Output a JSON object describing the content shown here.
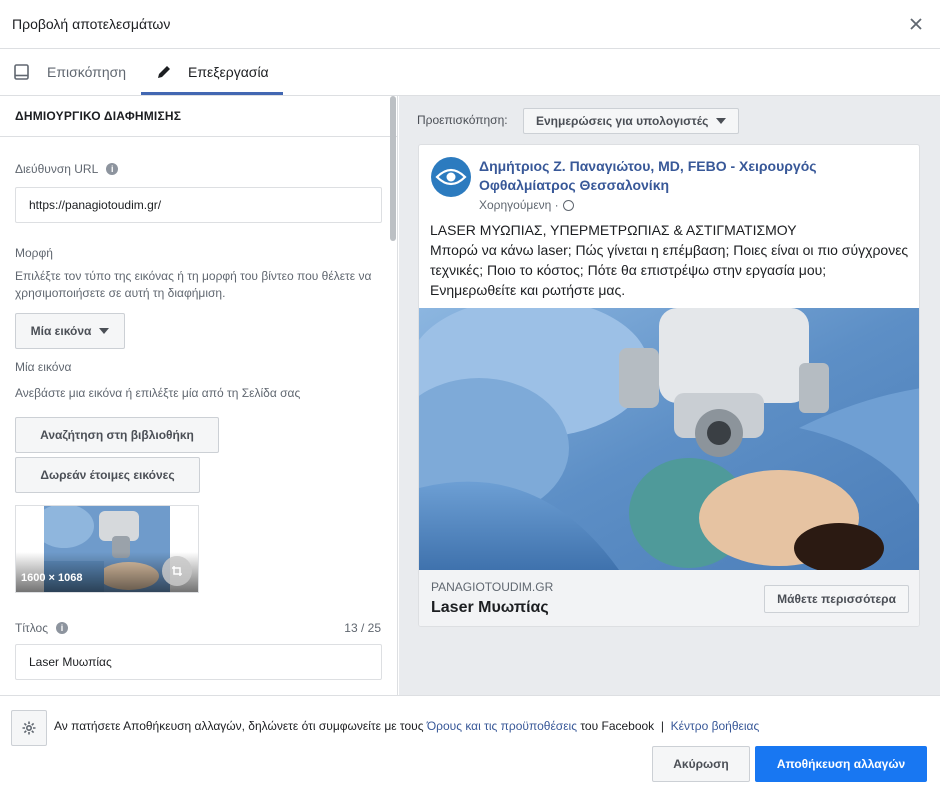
{
  "header": {
    "title": "Προβολή αποτελεσμάτων",
    "close_icon": "close-icon"
  },
  "tabs": [
    {
      "label": "Επισκόπηση",
      "icon": "tablet-icon"
    },
    {
      "label": "Επεξεργασία",
      "icon": "pencil-icon",
      "active": true
    }
  ],
  "left": {
    "section_title": "ΔΗΜΙΟΥΡΓΙΚΟ ΔΙΑΦΗΜΙΣΗΣ",
    "url_label": "Διεύθυνση URL",
    "url_value": "https://panagiotoudim.gr/",
    "format_label": "Μορφή",
    "format_help": "Επιλέξτε τον τύπο της εικόνας ή τη μορφή του βίντεο που θέλετε να χρησιμοποιήσετε σε αυτή τη διαφήμιση.",
    "format_select": "Μία εικόνα",
    "single_image_label": "Μία εικόνα",
    "single_image_help": "Ανεβάστε μια εικόνα ή επιλέξτε μία από τη Σελίδα σας",
    "search_library_btn": "Αναζήτηση στη βιβλιοθήκη",
    "free_images_btn": "Δωρεάν έτοιμες εικόνες",
    "thumb_size": "1600 × 1068",
    "title_label": "Τίτλος",
    "title_counter": "13 / 25",
    "title_value": "Laser Μυωπίας"
  },
  "preview": {
    "label": "Προεπισκόπηση:",
    "placement": "Ενημερώσεις για υπολογιστές",
    "page_name": "Δημήτριος Ζ. Παναγιώτου, MD, FEBO - Χειρουργός Οφθαλμίατρος Θεσσαλονίκη",
    "sponsored": "Χορηγούμενη ·",
    "text_line1": "LASER ΜΥΩΠΙΑΣ, ΥΠΕΡΜΕΤΡΩΠΙΑΣ & ΑΣΤΙΓΜΑΤΙΣΜΟΥ",
    "text_line2": "Μπορώ να κάνω laser; Πώς γίνεται η επέμβαση; Ποιες είναι οι πιο σύγχρονες τεχνικές; Ποιο το κόστος; Πότε θα επιστρέψω στην εργασία μου; Ενημερωθείτε και ρωτήστε μας.",
    "domain": "PANAGIOTOUDIM.GR",
    "headline": "Laser Μυωπίας",
    "cta": "Μάθετε περισσότερα"
  },
  "footer": {
    "terms_prefix": "Αν πατήσετε Αποθήκευση αλλαγών, δηλώνετε ότι συμφωνείτε με τους",
    "terms_link": "Όρους και τις προϋποθέσεις",
    "terms_suffix": "του Facebook",
    "separator": "|",
    "help_link": "Κέντρο βοήθειας",
    "cancel": "Ακύρωση",
    "save": "Αποθήκευση αλλαγών"
  },
  "colors": {
    "accent": "#4267b2",
    "primary_button": "#1877f2",
    "link": "#385898"
  }
}
